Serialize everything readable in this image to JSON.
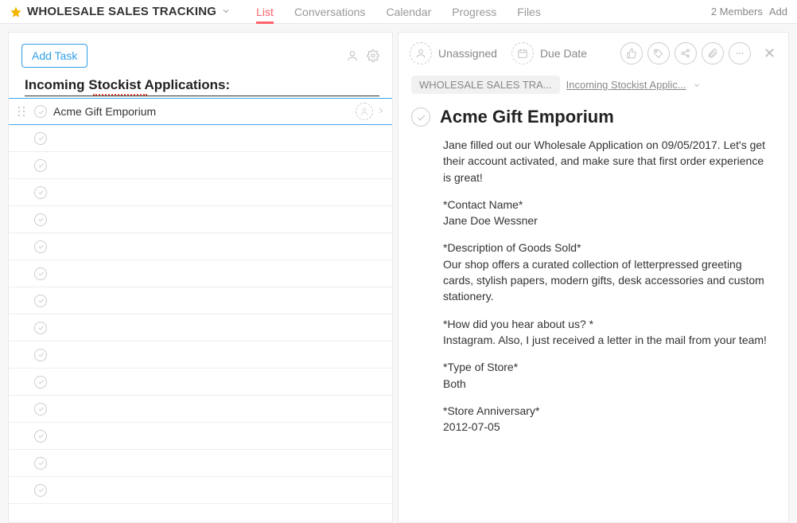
{
  "header": {
    "project_title": "WHOLESALE SALES TRACKING",
    "tabs": [
      "List",
      "Conversations",
      "Calendar",
      "Progress",
      "Files"
    ],
    "active_tab": 0,
    "members_text": "2 Members",
    "add_text": "Add"
  },
  "left": {
    "add_task_label": "Add Task",
    "section_title": "Incoming Stockist Applications:",
    "tasks": [
      {
        "title": "Acme Gift Emporium"
      }
    ],
    "empty_rows": 14
  },
  "detail": {
    "assignee_label": "Unassigned",
    "due_label": "Due Date",
    "crumb1": "WHOLESALE SALES TRA...",
    "crumb2": "Incoming Stockist Applic...",
    "title": "Acme Gift Emporium",
    "body": [
      "Jane filled out our Wholesale Application on 09/05/2017. Let's get their account activated, and make sure that first order experience is great!",
      "*Contact Name*\nJane Doe Wessner",
      "*Description of Goods Sold*\nOur shop offers a curated collection of letterpressed greeting cards, stylish papers, modern gifts, desk accessories and custom stationery.",
      "*How did you hear about us? *\nInstagram. Also, I just received a letter in the mail from your team!",
      "*Type of Store*\nBoth",
      "*Store Anniversary*\n2012-07-05"
    ]
  }
}
